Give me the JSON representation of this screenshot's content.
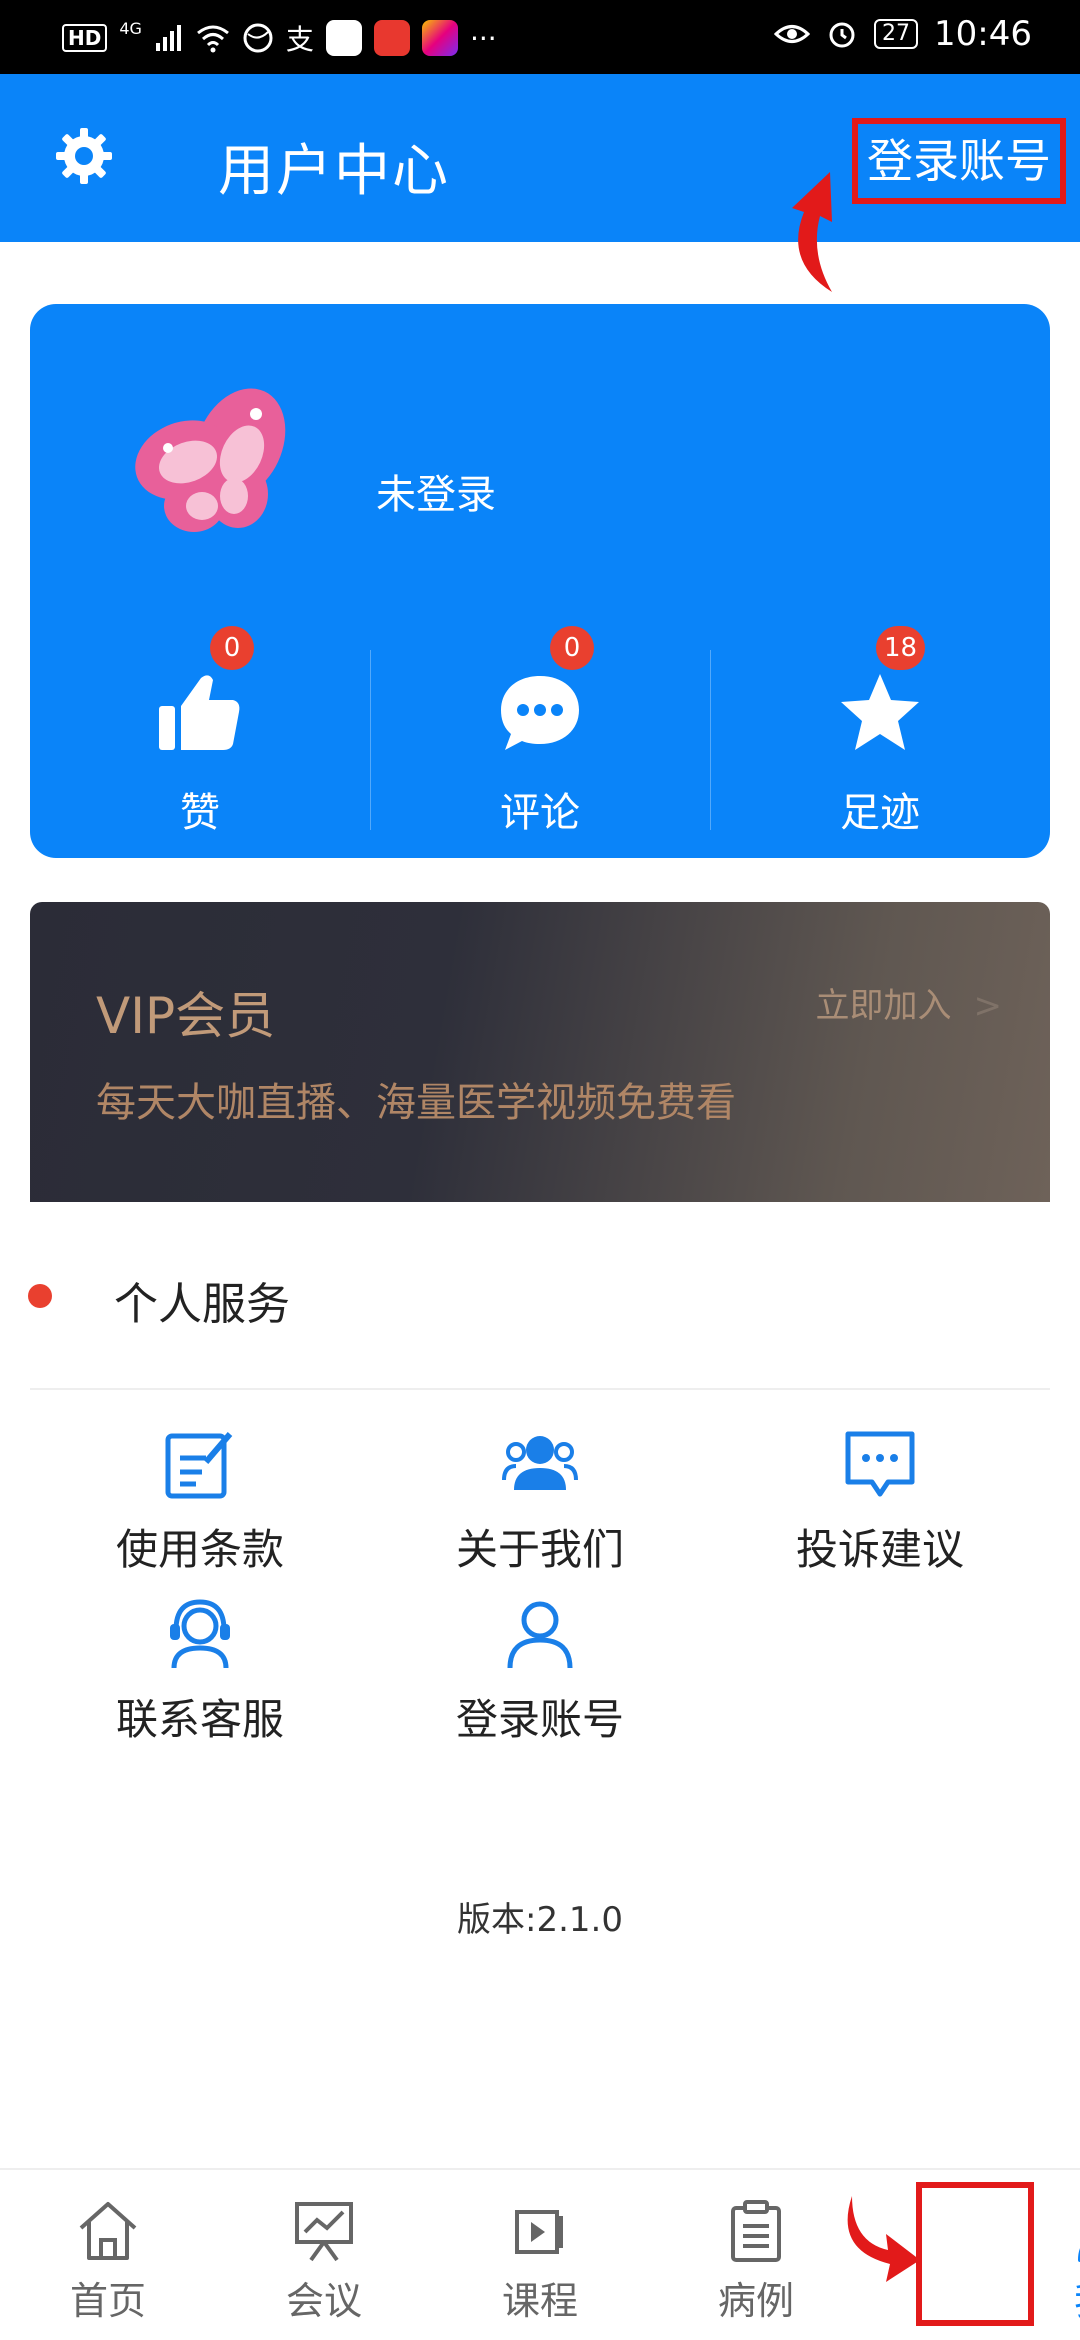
{
  "status_bar": {
    "hd": "HD",
    "network": "4G",
    "more": "···",
    "battery": "27",
    "time": "10:46"
  },
  "header": {
    "title": "用户中心",
    "login_link": "登录账号"
  },
  "user_card": {
    "login_status": "未登录",
    "stats": [
      {
        "label": "赞",
        "badge": "0",
        "icon": "thumbs-up-icon"
      },
      {
        "label": "评论",
        "badge": "0",
        "icon": "comment-icon"
      },
      {
        "label": "足迹",
        "badge": "18",
        "icon": "star-icon"
      }
    ]
  },
  "vip": {
    "title": "VIP会员",
    "join": "立即加入",
    "join_arrow": ">",
    "subtitle": "每天大咖直播、海量医学视频免费看"
  },
  "services": {
    "title": "个人服务",
    "items": [
      {
        "label": "使用条款",
        "icon": "edit-document-icon"
      },
      {
        "label": "关于我们",
        "icon": "group-icon"
      },
      {
        "label": "投诉建议",
        "icon": "feedback-icon"
      },
      {
        "label": "联系客服",
        "icon": "customer-service-icon"
      },
      {
        "label": "登录账号",
        "icon": "user-icon"
      }
    ]
  },
  "version": "版本:2.1.0",
  "tabbar": {
    "items": [
      {
        "label": "首页",
        "icon": "home-icon"
      },
      {
        "label": "会议",
        "icon": "presentation-icon"
      },
      {
        "label": "课程",
        "icon": "video-icon"
      },
      {
        "label": "病例",
        "icon": "clipboard-icon"
      },
      {
        "label": "我的",
        "icon": "user-icon"
      }
    ],
    "active": "我的"
  },
  "colors": {
    "primary": "#0a84f9",
    "badge": "#e9402f",
    "highlight": "#e21a1a",
    "vip_text": "#c19a79"
  }
}
